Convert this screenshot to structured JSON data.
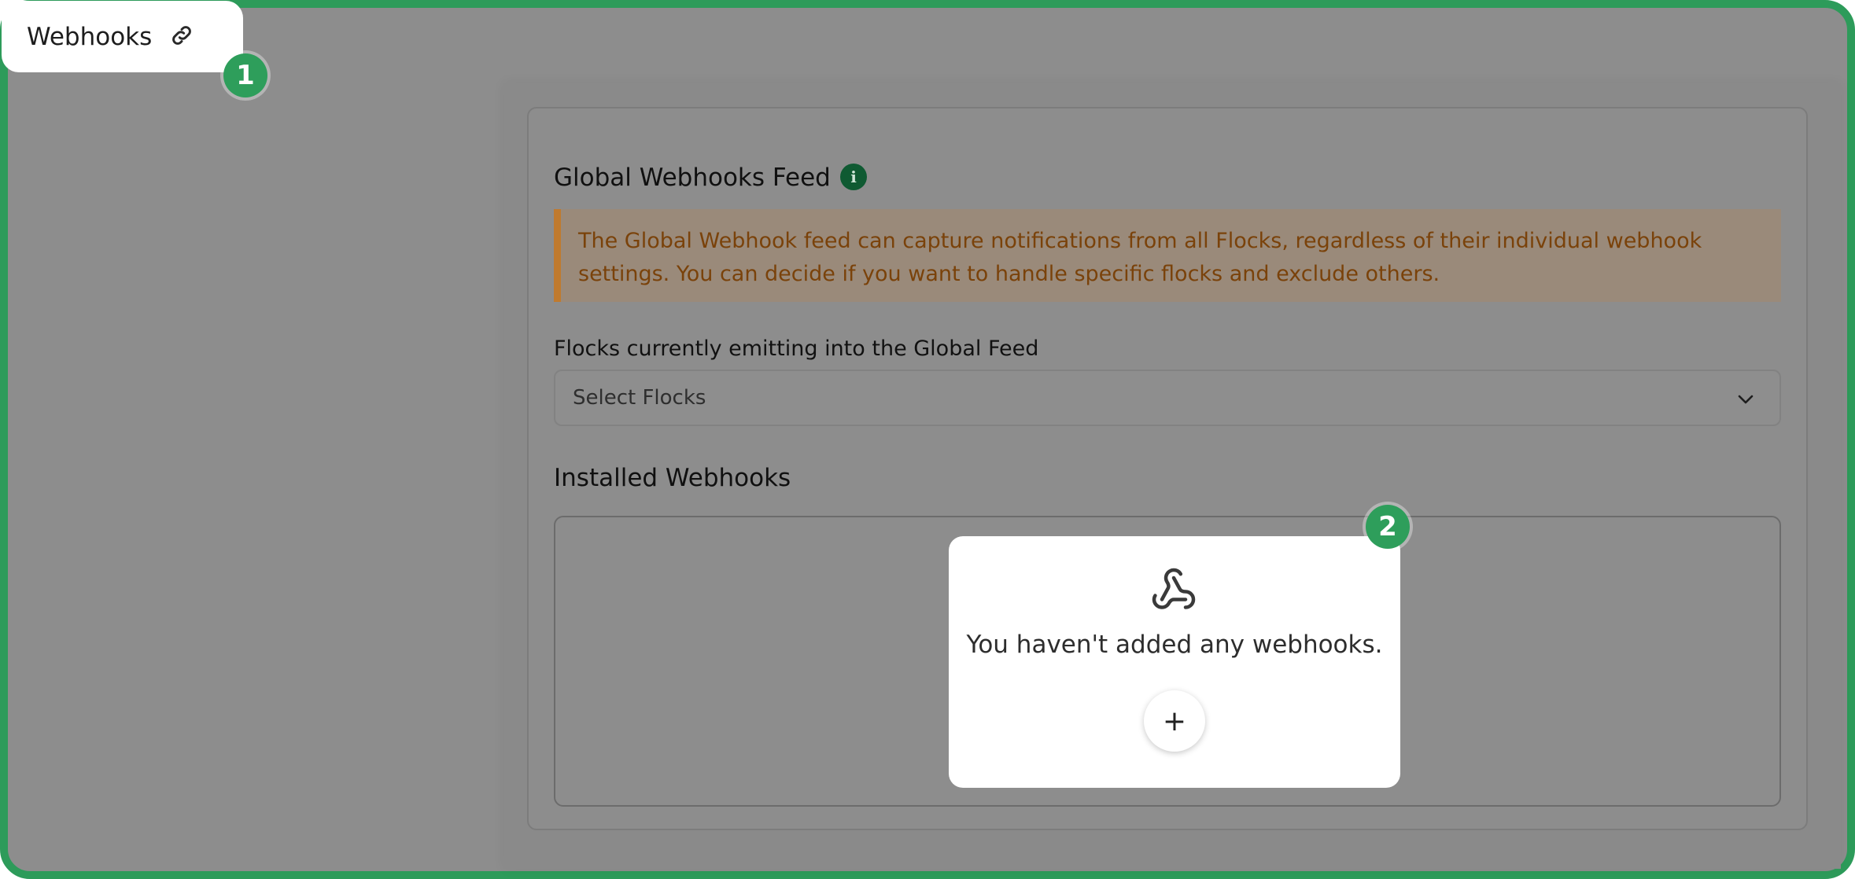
{
  "tab": {
    "label": "Webhooks",
    "icon": "link-icon"
  },
  "badges": {
    "first": "1",
    "second": "2"
  },
  "global_feed": {
    "title": "Global Webhooks Feed",
    "info_icon_glyph": "i",
    "warning_text": "The Global Webhook feed can capture notifications from all Flocks, regardless of their individual webhook settings. You can decide if you want to handle specific flocks and exclude others.",
    "field_label": "Flocks currently emitting into the Global Feed",
    "select_placeholder": "Select Flocks"
  },
  "installed": {
    "title": "Installed Webhooks",
    "empty_text": "You haven't added any webhooks.",
    "add_label": "+",
    "icon": "webhook-icon"
  },
  "colors": {
    "accent": "#2d9b5a",
    "warning_border": "#c07a2e",
    "info_icon": "#0f5a32"
  }
}
